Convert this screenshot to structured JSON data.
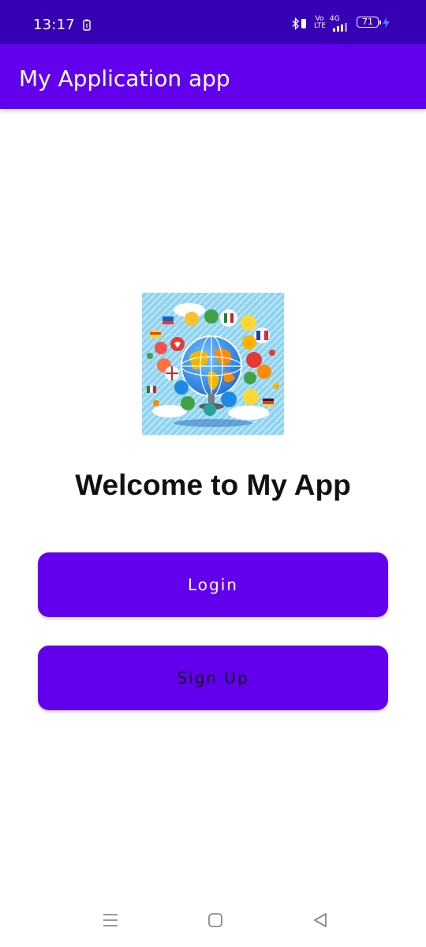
{
  "status_bar": {
    "time": "13:17",
    "network_volte": "Vo LTE",
    "network_type": "4G",
    "battery_level": "71",
    "icons": [
      "clipboard-icon",
      "bluetooth-icon",
      "vibrate-icon",
      "volte-icon",
      "signal-icon",
      "battery-icon",
      "charging-icon"
    ]
  },
  "app_bar": {
    "title": "My Application app"
  },
  "main": {
    "hero_image_icon": "globe-languages-illustration",
    "welcome_text": "Welcome to My App",
    "login_label": "Login",
    "signup_label": "Sign Up"
  },
  "nav_bar": {
    "icons": [
      "recent-apps-icon",
      "home-icon",
      "back-icon"
    ]
  },
  "colors": {
    "status_bar": "#3700b3",
    "primary": "#6200ee",
    "background": "#ffffff",
    "login_text": "#ffffff",
    "signup_text": "#111111"
  }
}
